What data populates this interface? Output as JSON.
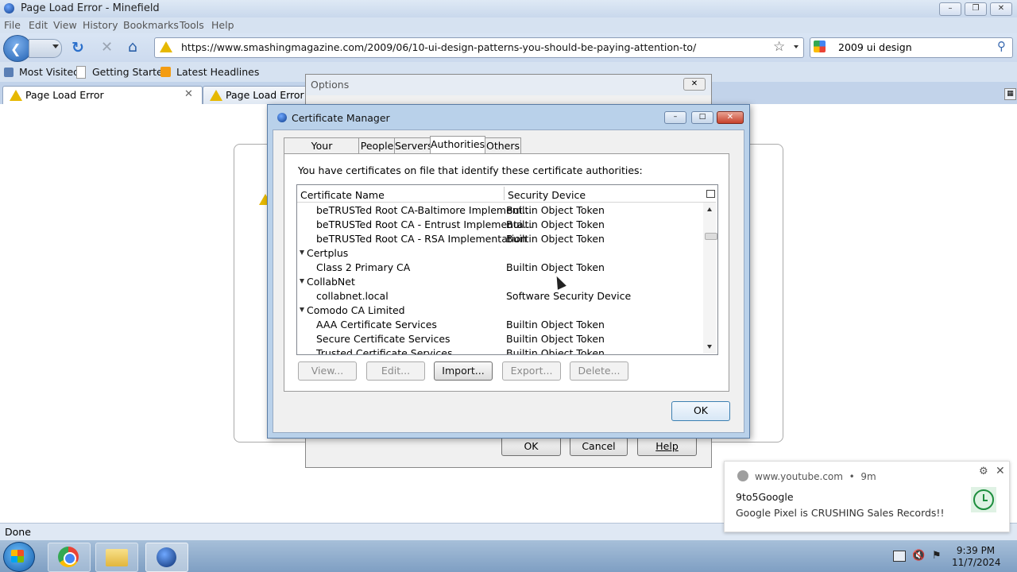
{
  "window": {
    "title": "Page Load Error - Minefield"
  },
  "menu": [
    "File",
    "Edit",
    "View",
    "History",
    "Bookmarks",
    "Tools",
    "Help"
  ],
  "nav": {
    "url": "https://www.smashingmagazine.com/2009/06/10-ui-design-patterns-you-should-be-paying-attention-to/",
    "search_value": "2009 ui design"
  },
  "bookmarks": [
    "Most Visited",
    "Getting Started",
    "Latest Headlines"
  ],
  "tabs": [
    {
      "label": "Page Load Error"
    },
    {
      "label": "Page Load Error"
    }
  ],
  "status": "Done",
  "options_dialog": {
    "title": "Options",
    "buttons": {
      "ok": "OK",
      "cancel": "Cancel",
      "help": "Help"
    }
  },
  "cert_manager": {
    "title": "Certificate Manager",
    "tabs": [
      "Your Certificates",
      "People",
      "Servers",
      "Authorities",
      "Others"
    ],
    "selected_tab": "Authorities",
    "description": "You have certificates on file that identify these certificate authorities:",
    "columns": [
      "Certificate Name",
      "Security Device"
    ],
    "rows": [
      {
        "name": "beTRUSTed Root CA-Baltimore Implement...",
        "device": "Builtin Object Token",
        "group": false
      },
      {
        "name": "beTRUSTed Root CA - Entrust Implementa...",
        "device": "Builtin Object Token",
        "group": false
      },
      {
        "name": "beTRUSTed Root CA - RSA Implementation",
        "device": "Builtin Object Token",
        "group": false
      },
      {
        "name": "Certplus",
        "device": "",
        "group": true
      },
      {
        "name": "Class 2 Primary CA",
        "device": "Builtin Object Token",
        "group": false
      },
      {
        "name": "CollabNet",
        "device": "",
        "group": true
      },
      {
        "name": "collabnet.local",
        "device": "Software Security Device",
        "group": false
      },
      {
        "name": "Comodo CA Limited",
        "device": "",
        "group": true
      },
      {
        "name": "AAA Certificate Services",
        "device": "Builtin Object Token",
        "group": false
      },
      {
        "name": "Secure Certificate Services",
        "device": "Builtin Object Token",
        "group": false
      },
      {
        "name": "Trusted Certificate Services",
        "device": "Builtin Object Token",
        "group": false
      }
    ],
    "buttons": {
      "view": "View...",
      "edit": "Edit...",
      "import": "Import...",
      "export": "Export...",
      "delete": "Delete..."
    },
    "ok": "OK"
  },
  "notification": {
    "site": "www.youtube.com",
    "age": "9m",
    "title": "9to5Google",
    "body": "Google Pixel is CRUSHING Sales Records!!"
  },
  "taskbar": {
    "time": "9:39 PM",
    "date": "11/7/2024"
  }
}
